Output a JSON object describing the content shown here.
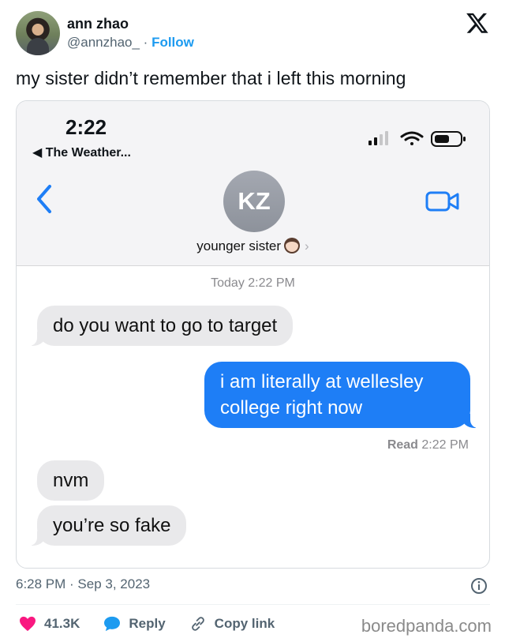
{
  "tweet": {
    "author_name": "ann zhao",
    "handle": "@annzhao_",
    "separator": " · ",
    "follow_label": "Follow",
    "text": "my sister didn’t remember that i left this morning",
    "timestamp": "6:28 PM · Sep 3, 2023",
    "likes": "41.3K",
    "reply_label": "Reply",
    "copy_link_label": "Copy link"
  },
  "screenshot": {
    "status_time": "2:22",
    "back_app": "◀ The Weather...",
    "contact_initials": "KZ",
    "contact_name": "younger sister",
    "day_label": "Today 2:22 PM",
    "messages": [
      {
        "from": "them",
        "text": "do you want to go to target"
      },
      {
        "from": "me",
        "text": "i am literally at wellesley college right now"
      },
      {
        "from": "them",
        "text": "nvm"
      },
      {
        "from": "them",
        "text": "you’re so fake"
      }
    ],
    "read_label": "Read",
    "read_time": "2:22 PM"
  },
  "watermark": "boredpanda.com",
  "colors": {
    "imessage_blue": "#1e7ef6",
    "received_gray": "#e9e9eb",
    "follow_blue": "#1d9bf0",
    "like_red": "#f91880"
  },
  "icons": [
    "x-logo-icon",
    "chevron-left-icon",
    "video-camera-icon",
    "signal-icon",
    "wifi-icon",
    "battery-icon",
    "heart-icon",
    "reply-bubble-icon",
    "link-icon",
    "info-icon"
  ]
}
